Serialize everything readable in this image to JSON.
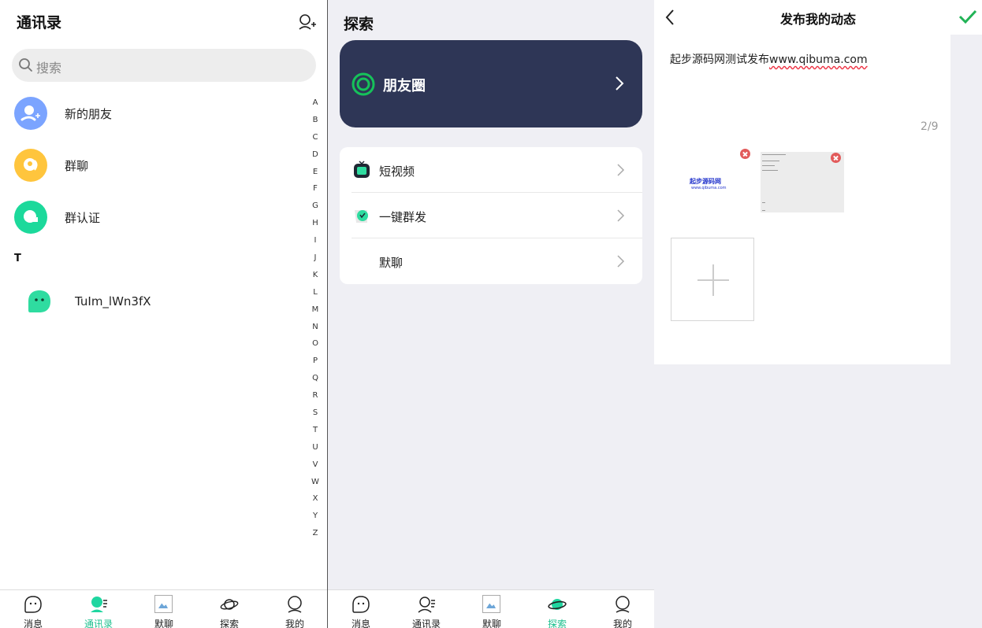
{
  "contacts": {
    "title": "通讯录",
    "search_placeholder": "搜索",
    "entries": [
      {
        "label": "新的朋友",
        "icon": "new-friend-icon",
        "color": "#7ba4ff"
      },
      {
        "label": "群聊",
        "icon": "group-chat-icon",
        "color": "#ffc53d"
      },
      {
        "label": "群认证",
        "icon": "group-verify-icon",
        "color": "#1cd99b"
      }
    ],
    "section_letter": "T",
    "contact_name": "TuIm_lWn3fX",
    "alpha_index": [
      "A",
      "B",
      "C",
      "D",
      "E",
      "F",
      "G",
      "H",
      "I",
      "J",
      "K",
      "L",
      "M",
      "N",
      "O",
      "P",
      "Q",
      "R",
      "S",
      "T",
      "U",
      "V",
      "W",
      "X",
      "Y",
      "Z"
    ],
    "tabs": [
      "消息",
      "通讯录",
      "默聊",
      "探索",
      "我的"
    ],
    "active_tab": "通讯录"
  },
  "discover": {
    "title": "探索",
    "moments_label": "朋友圈",
    "menu": [
      "短视频",
      "一键群发",
      "默聊"
    ],
    "tabs": [
      "消息",
      "通讯录",
      "默聊",
      "探索",
      "我的"
    ],
    "active_tab": "探索"
  },
  "publish": {
    "title": "发布我的动态",
    "post_prefix": "起步源码网测试发布",
    "post_url": "www.qibuma.com",
    "image_count": "2/9",
    "thumb_logo": "起步源码网",
    "thumb_logo_sub": "www.qibuma.com"
  },
  "colors": {
    "accent": "#1fc08f",
    "moments_card": "#2e3656",
    "confirm": "#21b356",
    "remove": "#e25b5b"
  }
}
